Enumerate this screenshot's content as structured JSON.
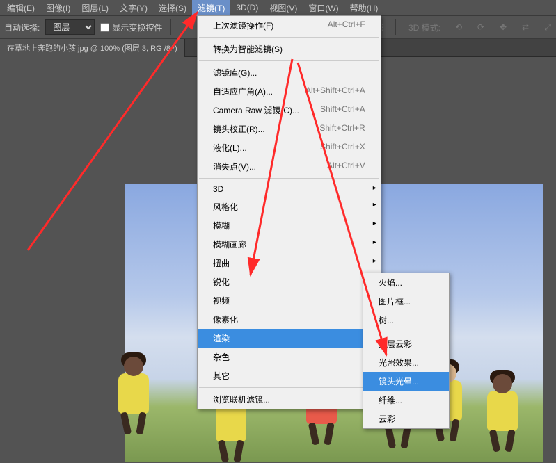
{
  "menubar": {
    "items": [
      {
        "label": "编辑(E)"
      },
      {
        "label": "图像(I)"
      },
      {
        "label": "图层(L)"
      },
      {
        "label": "文字(Y)"
      },
      {
        "label": "选择(S)"
      },
      {
        "label": "滤镜(T)",
        "active": true
      },
      {
        "label": "3D(D)"
      },
      {
        "label": "视图(V)"
      },
      {
        "label": "窗口(W)"
      },
      {
        "label": "帮助(H)"
      }
    ]
  },
  "toolbar": {
    "auto_select_label": "自动选择:",
    "layer_select_value": "图层",
    "show_transform_label": "显示变换控件",
    "mode3d_label": "3D 模式:"
  },
  "tab": {
    "title": "在草地上奔跑的小孩.jpg @ 100% (图层 3, RG  /8#)"
  },
  "filter_menu": {
    "last_filter": {
      "label": "上次滤镜操作(F)",
      "key": "Alt+Ctrl+F"
    },
    "smart": {
      "label": "转换为智能滤镜(S)"
    },
    "gallery": {
      "label": "滤镜库(G)..."
    },
    "adaptive": {
      "label": "自适应广角(A)...",
      "key": "Alt+Shift+Ctrl+A"
    },
    "camera_raw": {
      "label": "Camera Raw 滤镜(C)...",
      "key": "Shift+Ctrl+A"
    },
    "lens_corr": {
      "label": "镜头校正(R)...",
      "key": "Shift+Ctrl+R"
    },
    "liquify": {
      "label": "液化(L)...",
      "key": "Shift+Ctrl+X"
    },
    "vanishing": {
      "label": "消失点(V)...",
      "key": "Alt+Ctrl+V"
    },
    "sub_3d": {
      "label": "3D"
    },
    "stylize": {
      "label": "风格化"
    },
    "blur": {
      "label": "模糊"
    },
    "blur_gallery": {
      "label": "模糊画廊"
    },
    "distort": {
      "label": "扭曲"
    },
    "sharpen": {
      "label": "锐化"
    },
    "video": {
      "label": "视频"
    },
    "pixelate": {
      "label": "像素化"
    },
    "render": {
      "label": "渲染"
    },
    "noise": {
      "label": "杂色"
    },
    "other": {
      "label": "其它"
    },
    "browse": {
      "label": "浏览联机滤镜..."
    }
  },
  "render_menu": {
    "flame": {
      "label": "火焰..."
    },
    "picture_frame": {
      "label": "图片框..."
    },
    "tree": {
      "label": "树..."
    },
    "clouds_diff": {
      "label": "分层云彩"
    },
    "lighting": {
      "label": "光照效果..."
    },
    "lens_flare": {
      "label": "镜头光晕..."
    },
    "fibers": {
      "label": "纤维..."
    },
    "clouds": {
      "label": "云彩"
    }
  }
}
